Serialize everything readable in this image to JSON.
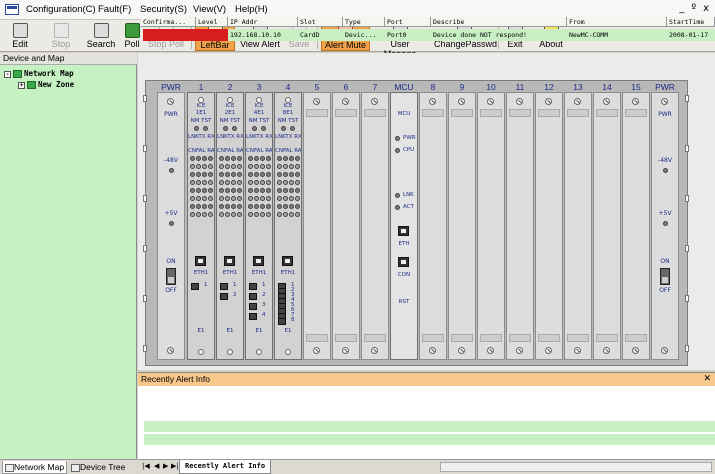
{
  "menu": [
    "Configuration(C)",
    "Fault(F)",
    "Security(S)",
    "View(V)",
    "Help(H)"
  ],
  "window_controls": [
    "_",
    "º",
    "x"
  ],
  "toolbar": [
    {
      "label": "Edit",
      "state": "normal"
    },
    {
      "label": "Stop",
      "state": "disabled"
    },
    {
      "label": "Search",
      "state": "normal"
    },
    {
      "label": "Poll",
      "state": "normal"
    },
    {
      "label": "Stop Poll",
      "state": "disabled"
    },
    {
      "label": "LeftBar",
      "state": "active"
    },
    {
      "label": "View Alert",
      "state": "normal"
    },
    {
      "label": "Save",
      "state": "disabled"
    },
    {
      "label": "Alert Mute",
      "state": "active"
    },
    {
      "label": "User Manage",
      "state": "normal"
    },
    {
      "label": "ChangePasswd",
      "state": "normal"
    },
    {
      "label": "Exit",
      "state": "normal"
    },
    {
      "label": "About",
      "state": "normal"
    }
  ],
  "left_panel": {
    "title": "Device and Map",
    "tree": [
      {
        "label": "Network Map",
        "expander": "-"
      },
      {
        "label": "New Zone",
        "expander": "+"
      }
    ],
    "tabs": [
      "Network Map",
      "Device Tree"
    ]
  },
  "chassis": {
    "slot_labels": [
      "PWR",
      "1",
      "2",
      "3",
      "4",
      "5",
      "6",
      "7",
      "MCU",
      "8",
      "9",
      "10",
      "11",
      "12",
      "13",
      "14",
      "15",
      "PWR"
    ],
    "cards": [
      {
        "name": "ICE",
        "sub": "1E1",
        "ports": [
          "1"
        ]
      },
      {
        "name": "ICE",
        "sub": "2E1",
        "ports": [
          "1",
          "2"
        ]
      },
      {
        "name": "ICE",
        "sub": "4E1",
        "ports": [
          "1",
          "2",
          "3",
          "4"
        ]
      },
      {
        "name": "ICE",
        "sub": "8E1",
        "ports": [
          "1",
          "2",
          "3",
          "4",
          "5",
          "6",
          "7",
          "8"
        ]
      }
    ],
    "card_text": {
      "nm_tst": "NM TST",
      "lnk": "LNKTX RX",
      "cnf": "CNFAL RA",
      "eth": "ETH1",
      "e1": "E1"
    },
    "mcu": {
      "title": "MCU",
      "pwr": "PWR",
      "cpu": "CPU",
      "lnk": "LNK",
      "act": "ACT",
      "eth": "ETH",
      "con": "CON",
      "rst": "RST"
    },
    "power": {
      "pwr": "PWR",
      "neg48": "-48V",
      "pos5": "+5V",
      "on": "ON",
      "off": "OFF"
    }
  },
  "alerts": {
    "title": "Recently Alert Info",
    "columns": [
      "Confirma...",
      "Level",
      "IP Addr",
      "Slot",
      "Type",
      "Port",
      "Describe",
      "From",
      "StartTime"
    ],
    "rows": [
      {
        "confirm": "",
        "level": "",
        "ip": "192.168.10.10",
        "slot": "CardD",
        "type": "Devic...",
        "port": "Port0",
        "describe": "Device done NOT respond!",
        "from": "NewMC-COMM",
        "start": "2008-01-17"
      }
    ],
    "tab": "Recently Alert Info"
  },
  "colors": {
    "accent_active": "#f1a34b",
    "alert_level": "#d71d1d",
    "tree_bg": "#c6f2c3",
    "alert_row": "#c8efc4",
    "alert_header": "#f7c78b"
  }
}
